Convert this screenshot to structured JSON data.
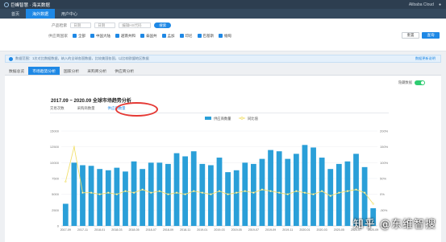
{
  "topbar": {
    "logo_text": "巨峰智慧 · 海关数据",
    "user": "Alibaba Cloud",
    "right_icon": "user-icon"
  },
  "nav": {
    "items": [
      "首页",
      "海外数据",
      "用户中心"
    ],
    "active_index": 1
  },
  "filter": {
    "row1_label": "产品检索",
    "row1_inputs": [
      "日期",
      "日期",
      "编辑HS代码"
    ],
    "row1_button": "搜索",
    "row2_label": "供应商国家",
    "countries": [
      "全部",
      "中国大陆",
      "越南共和",
      "泰国共",
      "孟加",
      "印尼",
      "巴基斯",
      "缅甸"
    ],
    "reset_label": "重置",
    "query_label": "查询"
  },
  "info": {
    "text": "数据范围：1次对比数据数据，纳入的全球各国数据，比较美国各国，以比较欧盟地区数据",
    "link": "数据更新说明"
  },
  "tabs": {
    "items": [
      "数据总览",
      "市场趋势分析",
      "国家分析",
      "采购商分析",
      "供应商分析"
    ],
    "active_index": 1
  },
  "panel": {
    "toggle_label": "隐藏数据",
    "title": "2017.09 ~ 2020.09 全球市场趋势分析",
    "subtabs": [
      "交易次数",
      "采购商数量",
      "供应商数量"
    ],
    "subtab_active": 2
  },
  "watermark": "知乎 @东维智搜",
  "colors": {
    "accent": "#1e88e5",
    "bar": "#2a9fd8",
    "line": "#f1df6b",
    "annotation": "#e53935"
  },
  "chart_data": {
    "type": "bar",
    "title": "2017.09 ~ 2020.09 全球市场趋势分析",
    "legend": [
      "供应商数量",
      "同比值"
    ],
    "legend_position": "top-center",
    "grid": true,
    "xlabel": "",
    "ylabel": "",
    "ylim": [
      0,
      15000
    ],
    "y2lim": [
      -100,
      200
    ],
    "yticks": [
      0,
      2500,
      5000,
      7500,
      10000,
      12500,
      15000
    ],
    "y2ticks": [
      "-100%",
      "-50%",
      "0%",
      "50%",
      "100%",
      "150%",
      "200%"
    ],
    "categories": [
      "2017-09",
      "2017-10",
      "2017-11",
      "2017-12",
      "2018-01",
      "2018-02",
      "2018-03",
      "2018-04",
      "2018-05",
      "2018-06",
      "2018-07",
      "2018-08",
      "2018-09",
      "2018-10",
      "2018-11",
      "2018-12",
      "2019-01",
      "2019-02",
      "2019-03",
      "2019-04",
      "2019-05",
      "2019-06",
      "2019-07",
      "2019-08",
      "2019-09",
      "2019-10",
      "2019-11",
      "2019-12",
      "2020-01",
      "2020-02",
      "2020-03",
      "2020-04",
      "2020-05",
      "2020-06",
      "2020-07",
      "2020-08",
      "2020-09"
    ],
    "xtick_labels": [
      "2017-09",
      "2017-11",
      "2018-01",
      "2018-03",
      "2018-05",
      "2018-07",
      "2018-09",
      "2018-11",
      "2019-01",
      "2019-03",
      "2019-05",
      "2019-07",
      "2019-09",
      "2019-11",
      "2020-01",
      "2020-03",
      "2020-05",
      "2020-07",
      "2020-09"
    ],
    "series": [
      {
        "name": "供应商数量",
        "type": "bar",
        "axis": "left",
        "values": [
          3500,
          10000,
          9600,
          9500,
          9000,
          8800,
          9200,
          8600,
          10200,
          9000,
          10000,
          10000,
          9800,
          11500,
          11000,
          11800,
          9800,
          9600,
          10800,
          8500,
          8800,
          10000,
          9800,
          10600,
          12000,
          11800,
          10600,
          11400,
          12800,
          12400,
          10800,
          9000,
          9800,
          10200,
          11400,
          9300,
          2800
        ]
      },
      {
        "name": "同比值",
        "type": "line",
        "axis": "right",
        "values": [
          40,
          150,
          5,
          5,
          0,
          5,
          0,
          10,
          5,
          15,
          5,
          10,
          0,
          5,
          0,
          10,
          5,
          0,
          10,
          0,
          5,
          10,
          5,
          15,
          10,
          5,
          0,
          10,
          5,
          0,
          10,
          -5,
          5,
          10,
          15,
          5,
          -30
        ]
      }
    ]
  }
}
